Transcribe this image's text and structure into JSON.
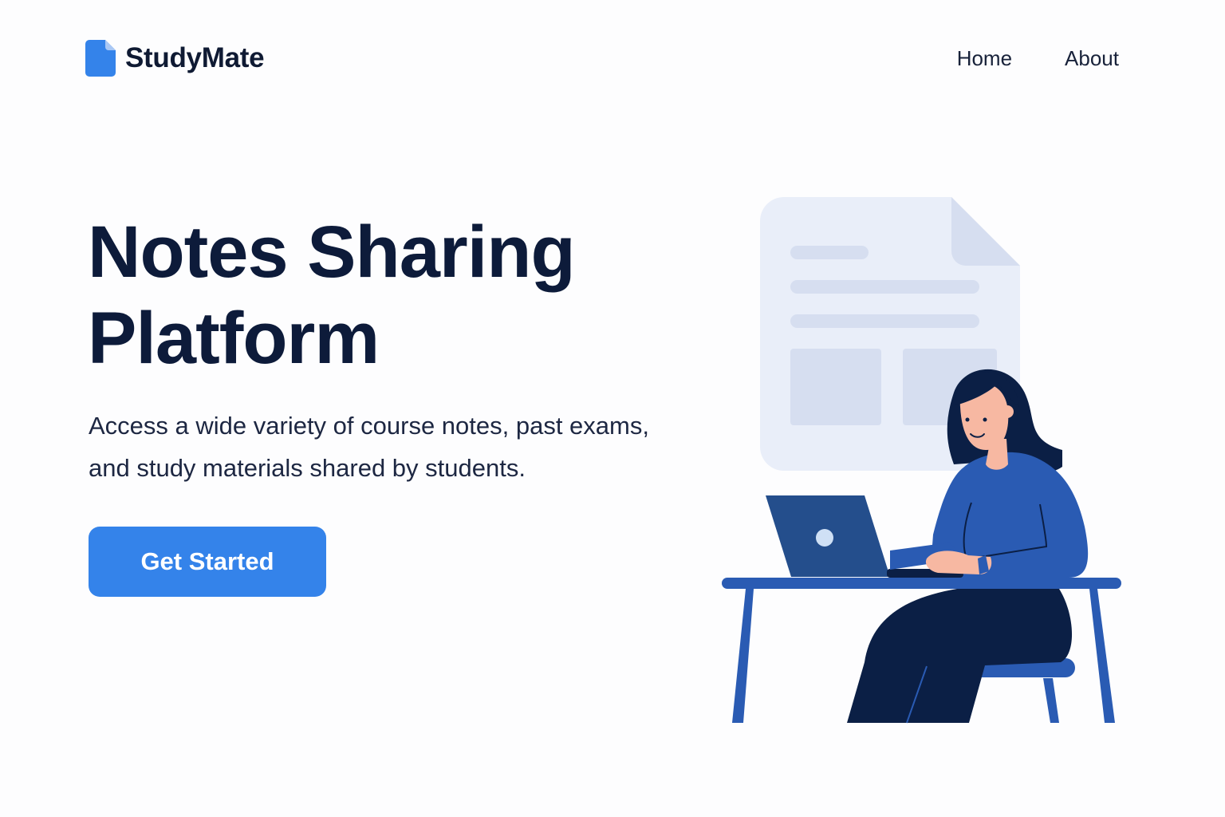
{
  "header": {
    "brand_name": "StudyMate",
    "brand_icon": "document-icon",
    "nav": [
      {
        "label": "Home"
      },
      {
        "label": "About"
      }
    ]
  },
  "hero": {
    "title_line1": "Notes Sharing",
    "title_line2": "Platform",
    "subtitle": "Access a wide variety of course notes, past exams, and study materials shared by students.",
    "cta_label": "Get Started"
  },
  "illustration": {
    "subject": "student-at-laptop-illustration",
    "background_icon": "document-icon"
  },
  "colors": {
    "accent": "#3483ea",
    "text_dark": "#0d1b3a",
    "illustration_blue": "#2a5bb3",
    "illustration_navy": "#0b1f45",
    "document_bg": "#e9eef9"
  }
}
